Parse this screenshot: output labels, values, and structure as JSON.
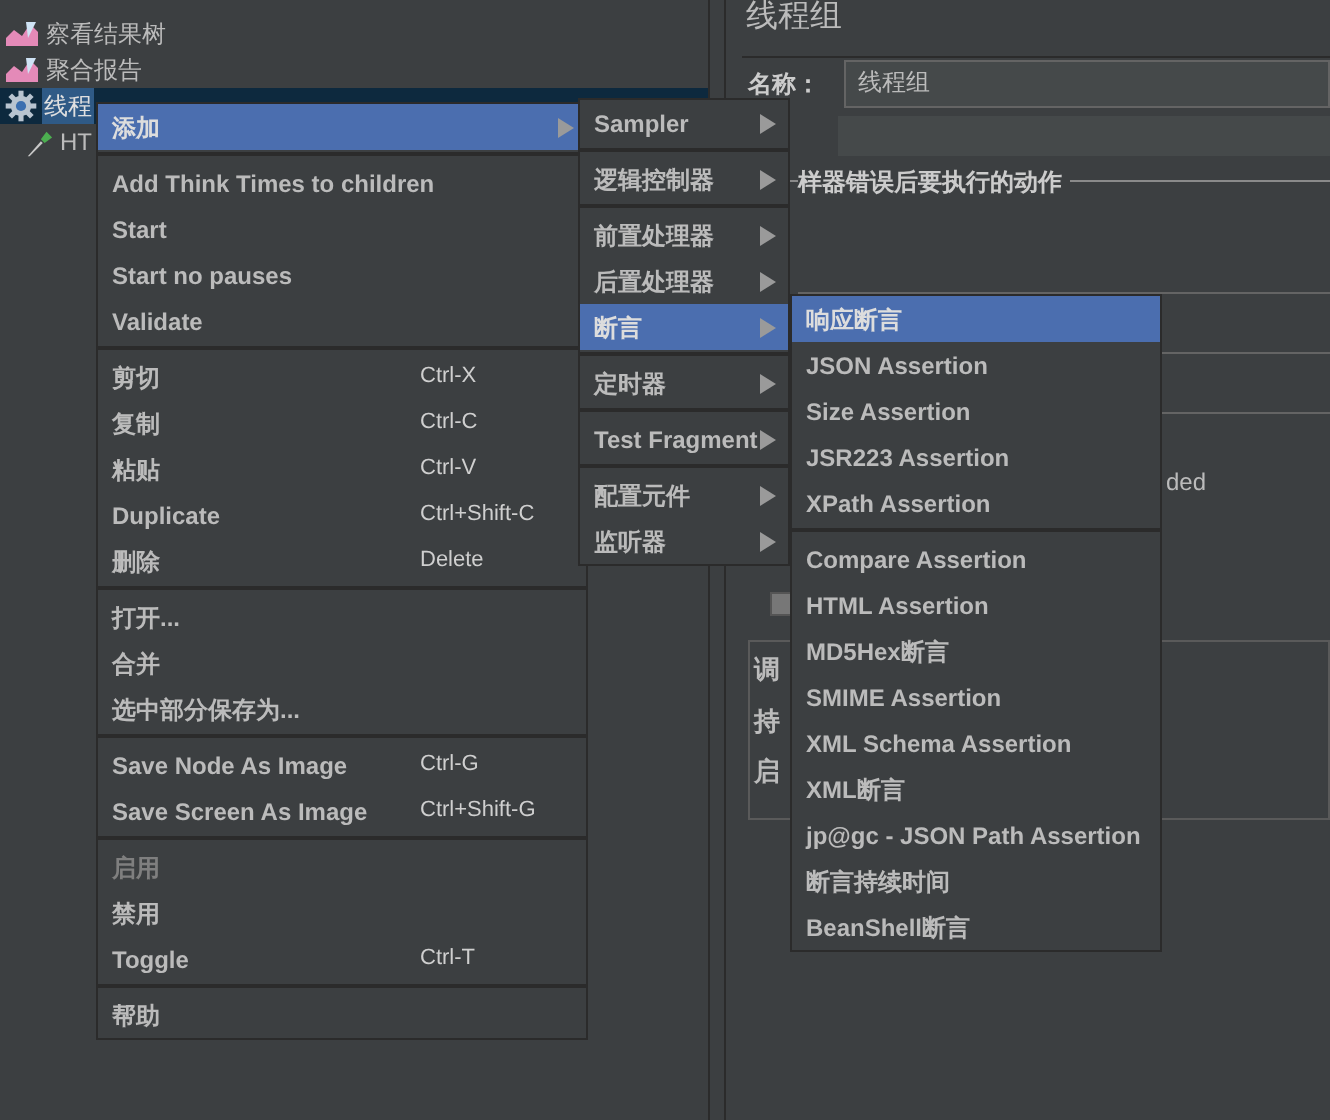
{
  "tree": {
    "items": [
      {
        "label": "察看结果树",
        "kind": "listener",
        "selected": false
      },
      {
        "label": "聚合报告",
        "kind": "listener",
        "selected": false
      },
      {
        "label": "线程",
        "kind": "thread-group",
        "selected": true,
        "children": [
          {
            "label": "HT",
            "kind": "sampler",
            "selected": false
          }
        ]
      }
    ]
  },
  "panel": {
    "title": "线程组",
    "name_label": "名称：",
    "name_value": "线程组",
    "legend": "样器错误后要执行的动作",
    "fragment_text": "ded",
    "checkbox": {
      "checked": false
    },
    "labels": [
      "调",
      "持",
      "启"
    ]
  },
  "context_menu": {
    "groups": [
      [
        {
          "label": "添加",
          "submenu": true,
          "selected": true,
          "disabled": false
        }
      ],
      [
        {
          "label": "Add Think Times to children",
          "submenu": false,
          "selected": false,
          "disabled": false
        },
        {
          "label": "Start",
          "submenu": false,
          "selected": false,
          "disabled": false
        },
        {
          "label": "Start no pauses",
          "submenu": false,
          "selected": false,
          "disabled": false
        },
        {
          "label": "Validate",
          "submenu": false,
          "selected": false,
          "disabled": false
        }
      ],
      [
        {
          "label": "剪切",
          "shortcut": "Ctrl-X",
          "submenu": false,
          "selected": false,
          "disabled": false
        },
        {
          "label": "复制",
          "shortcut": "Ctrl-C",
          "submenu": false,
          "selected": false,
          "disabled": false
        },
        {
          "label": "粘贴",
          "shortcut": "Ctrl-V",
          "submenu": false,
          "selected": false,
          "disabled": false
        },
        {
          "label": "Duplicate",
          "shortcut": "Ctrl+Shift-C",
          "submenu": false,
          "selected": false,
          "disabled": false
        },
        {
          "label": "删除",
          "shortcut": "Delete",
          "submenu": false,
          "selected": false,
          "disabled": false
        }
      ],
      [
        {
          "label": "打开...",
          "submenu": false,
          "selected": false,
          "disabled": false
        },
        {
          "label": "合并",
          "submenu": false,
          "selected": false,
          "disabled": false
        },
        {
          "label": "选中部分保存为...",
          "submenu": false,
          "selected": false,
          "disabled": false
        }
      ],
      [
        {
          "label": "Save Node As Image",
          "shortcut": "Ctrl-G",
          "submenu": false,
          "selected": false,
          "disabled": false
        },
        {
          "label": "Save Screen As Image",
          "shortcut": "Ctrl+Shift-G",
          "submenu": false,
          "selected": false,
          "disabled": false
        }
      ],
      [
        {
          "label": "启用",
          "submenu": false,
          "selected": false,
          "disabled": true
        },
        {
          "label": "禁用",
          "submenu": false,
          "selected": false,
          "disabled": false
        },
        {
          "label": "Toggle",
          "shortcut": "Ctrl-T",
          "submenu": false,
          "selected": false,
          "disabled": false
        }
      ],
      [
        {
          "label": "帮助",
          "submenu": false,
          "selected": false,
          "disabled": false
        }
      ]
    ]
  },
  "add_submenu": {
    "groups": [
      [
        {
          "label": "Sampler",
          "submenu": true,
          "selected": false
        }
      ],
      [
        {
          "label": "逻辑控制器",
          "submenu": true,
          "selected": false
        }
      ],
      [
        {
          "label": "前置处理器",
          "submenu": true,
          "selected": false
        },
        {
          "label": "后置处理器",
          "submenu": true,
          "selected": false
        },
        {
          "label": "断言",
          "submenu": true,
          "selected": true
        }
      ],
      [
        {
          "label": "定时器",
          "submenu": true,
          "selected": false
        }
      ],
      [
        {
          "label": "Test Fragment",
          "submenu": true,
          "selected": false
        }
      ],
      [
        {
          "label": "配置元件",
          "submenu": true,
          "selected": false
        },
        {
          "label": "监听器",
          "submenu": true,
          "selected": false
        }
      ]
    ]
  },
  "assertion_submenu": {
    "groups": [
      [
        {
          "label": "响应断言",
          "selected": true
        },
        {
          "label": "JSON Assertion",
          "selected": false
        },
        {
          "label": "Size Assertion",
          "selected": false
        },
        {
          "label": "JSR223 Assertion",
          "selected": false
        },
        {
          "label": "XPath Assertion",
          "selected": false
        }
      ],
      [
        {
          "label": "Compare Assertion",
          "selected": false
        },
        {
          "label": "HTML Assertion",
          "selected": false
        },
        {
          "label": "MD5Hex断言",
          "selected": false
        },
        {
          "label": "SMIME Assertion",
          "selected": false
        },
        {
          "label": "XML Schema Assertion",
          "selected": false
        },
        {
          "label": "XML断言",
          "selected": false
        },
        {
          "label": "jp@gc - JSON Path Assertion",
          "selected": false
        },
        {
          "label": "断言持续时间",
          "selected": false
        },
        {
          "label": "BeanShell断言",
          "selected": false
        }
      ]
    ]
  }
}
